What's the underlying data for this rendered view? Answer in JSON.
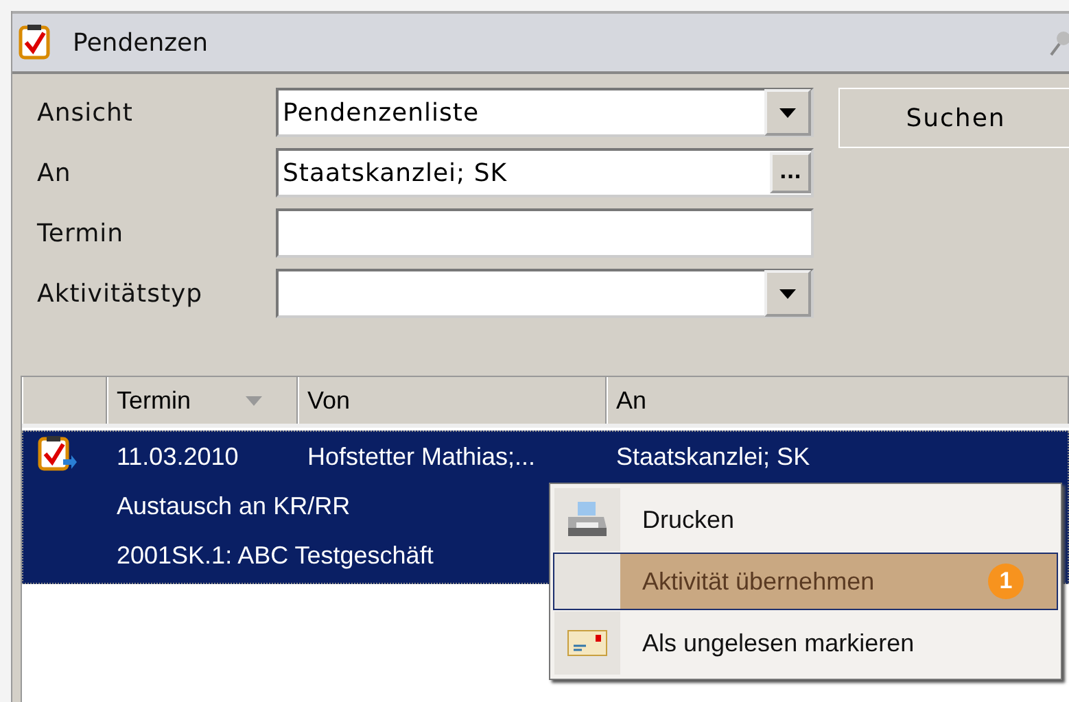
{
  "panel": {
    "title": "Pendenzen"
  },
  "form": [
    {
      "label": "Ansicht",
      "kind": "dropdown",
      "value": "Pendenzenliste"
    },
    {
      "label": "An",
      "kind": "picker",
      "value": "Staatskanzlei; SK",
      "button": "..."
    },
    {
      "label": "Termin",
      "kind": "text"
    },
    {
      "label": "Aktivitätstyp",
      "kind": "dropdown"
    }
  ],
  "search_button": "Suchen",
  "table": {
    "columns": [
      "Termin",
      "Von",
      "An"
    ],
    "rows": [
      {
        "selected": true,
        "termin": "11.03.2010",
        "von": "Hofstetter  Mathias;...",
        "an": "Staatskanzlei; SK",
        "subject": "Austausch an KR/RR",
        "business": "2001SK.1: ABC Testgeschäft"
      }
    ]
  },
  "context_menu": [
    {
      "label": "Drucken",
      "selected": false
    },
    {
      "label": "Aktivität übernehmen",
      "selected": true,
      "badge": "1"
    },
    {
      "label": "Als ungelesen markieren",
      "selected": false
    }
  ]
}
